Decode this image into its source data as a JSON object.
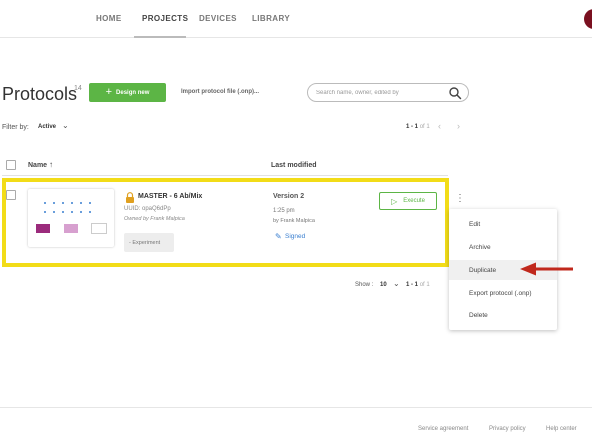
{
  "nav": {
    "items": [
      {
        "label": "HOME",
        "active": false
      },
      {
        "label": "PROJECTS",
        "active": true
      },
      {
        "label": "DEVICES",
        "active": false
      },
      {
        "label": "LIBRARY",
        "active": false
      }
    ]
  },
  "page": {
    "title": "Protocols",
    "count": "14",
    "design_button": "Design new",
    "import_link": "Import protocol file (.onp)...",
    "search_placeholder": "Search name, owner, edited by"
  },
  "filter": {
    "label": "Filter by:",
    "value": "Active"
  },
  "pagination_top": {
    "range": "1 - 1",
    "of_text": "of 1"
  },
  "table": {
    "col_name": "Name",
    "col_modified": "Last modified"
  },
  "protocol": {
    "name": "MASTER - 6 Ab/Mix",
    "uuid": "UUID: opaQ6dPp",
    "owner": "Owned by Frank Malpica",
    "tag": "Experiment",
    "tag_bullet": "-",
    "version": "Version 2",
    "time": "1:25 pm",
    "by": "by Frank Malpica",
    "signed": "Signed",
    "execute": "Execute"
  },
  "menu": {
    "items": [
      "Edit",
      "Archive",
      "Duplicate",
      "Export protocol (.onp)",
      "Delete"
    ],
    "highlighted": "Duplicate"
  },
  "pagination_bottom": {
    "show_label": "Show :",
    "show_value": "10",
    "range": "1 - 1",
    "of_text": "of 1"
  },
  "footer": {
    "links": [
      "Service agreement",
      "Privacy policy",
      "Help center"
    ]
  },
  "colors": {
    "primary_green": "#5cb545",
    "highlight_yellow": "#f2dc18",
    "arrow_red": "#c0281c",
    "link_blue": "#3a7fd0",
    "avatar": "#7a1020"
  }
}
